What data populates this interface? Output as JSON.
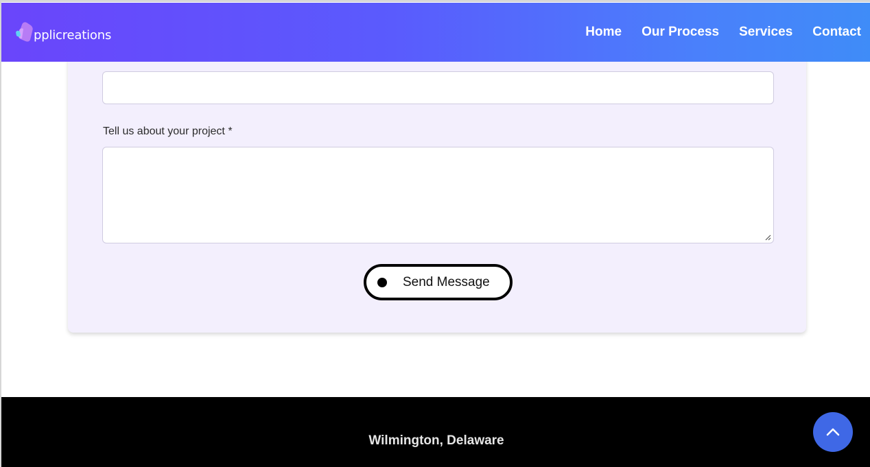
{
  "header": {
    "logo_text": "pplicreations",
    "nav": [
      "Home",
      "Our Process",
      "Services",
      "Contact"
    ]
  },
  "form": {
    "message_label": "Tell us about your project *",
    "message_value": "",
    "submit_label": "Send Message"
  },
  "footer": {
    "location": "Wilmington, Delaware"
  },
  "icons": {
    "logo": "applicreations-logo-icon",
    "scroll_top": "chevron-up-icon",
    "send_dot": "dot-icon",
    "resize": "resize-grip-icon"
  },
  "colors": {
    "header_gradient_start": "#6a45fb",
    "header_gradient_end": "#3f8cf8",
    "form_card_bg": "#f3effd",
    "footer_bg": "#000000",
    "scroll_top_bg": "#3f68e6"
  }
}
